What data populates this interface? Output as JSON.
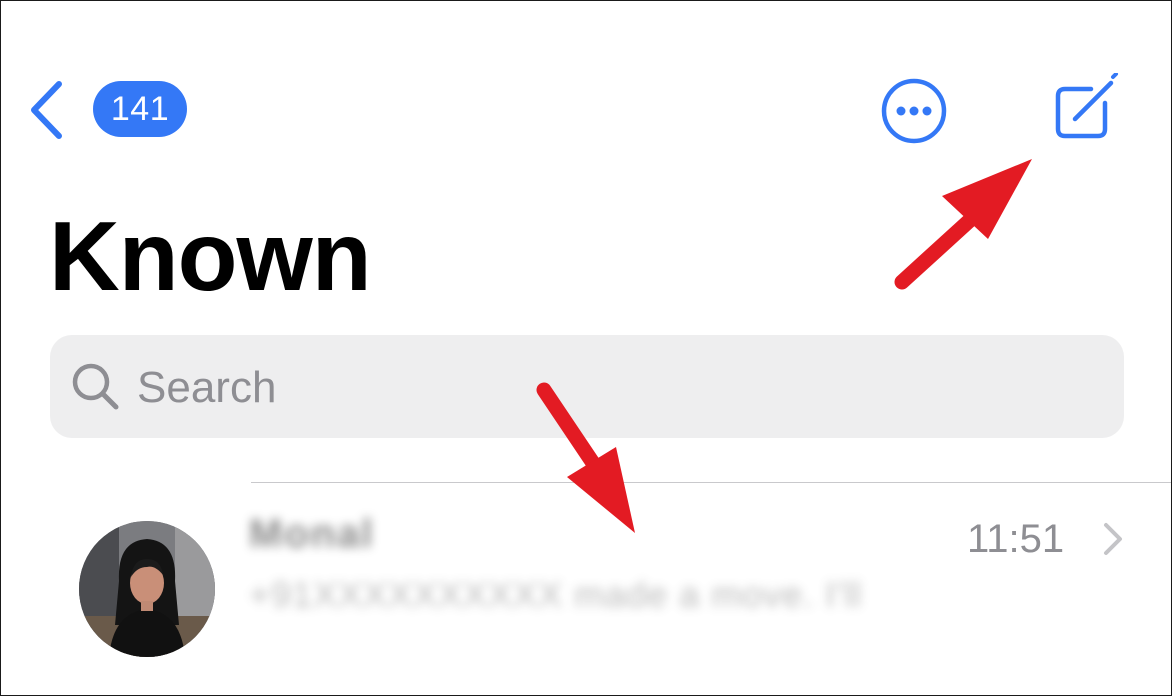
{
  "nav": {
    "unread_count": "141"
  },
  "title": "Known",
  "search": {
    "placeholder": "Search"
  },
  "conversations": [
    {
      "name": "Monal",
      "preview": "+91XXXXXXXXXX made a move. I'll",
      "time": "11:51"
    }
  ],
  "colors": {
    "accent": "#3478f6",
    "annotation": "#e31b23",
    "search_bg": "#eeeeef",
    "secondary_text": "#8e8e93"
  },
  "icons": {
    "back": "chevron-left-icon",
    "more": "ellipsis-circle-icon",
    "compose": "compose-icon",
    "search": "search-icon",
    "disclosure": "chevron-right-icon"
  }
}
